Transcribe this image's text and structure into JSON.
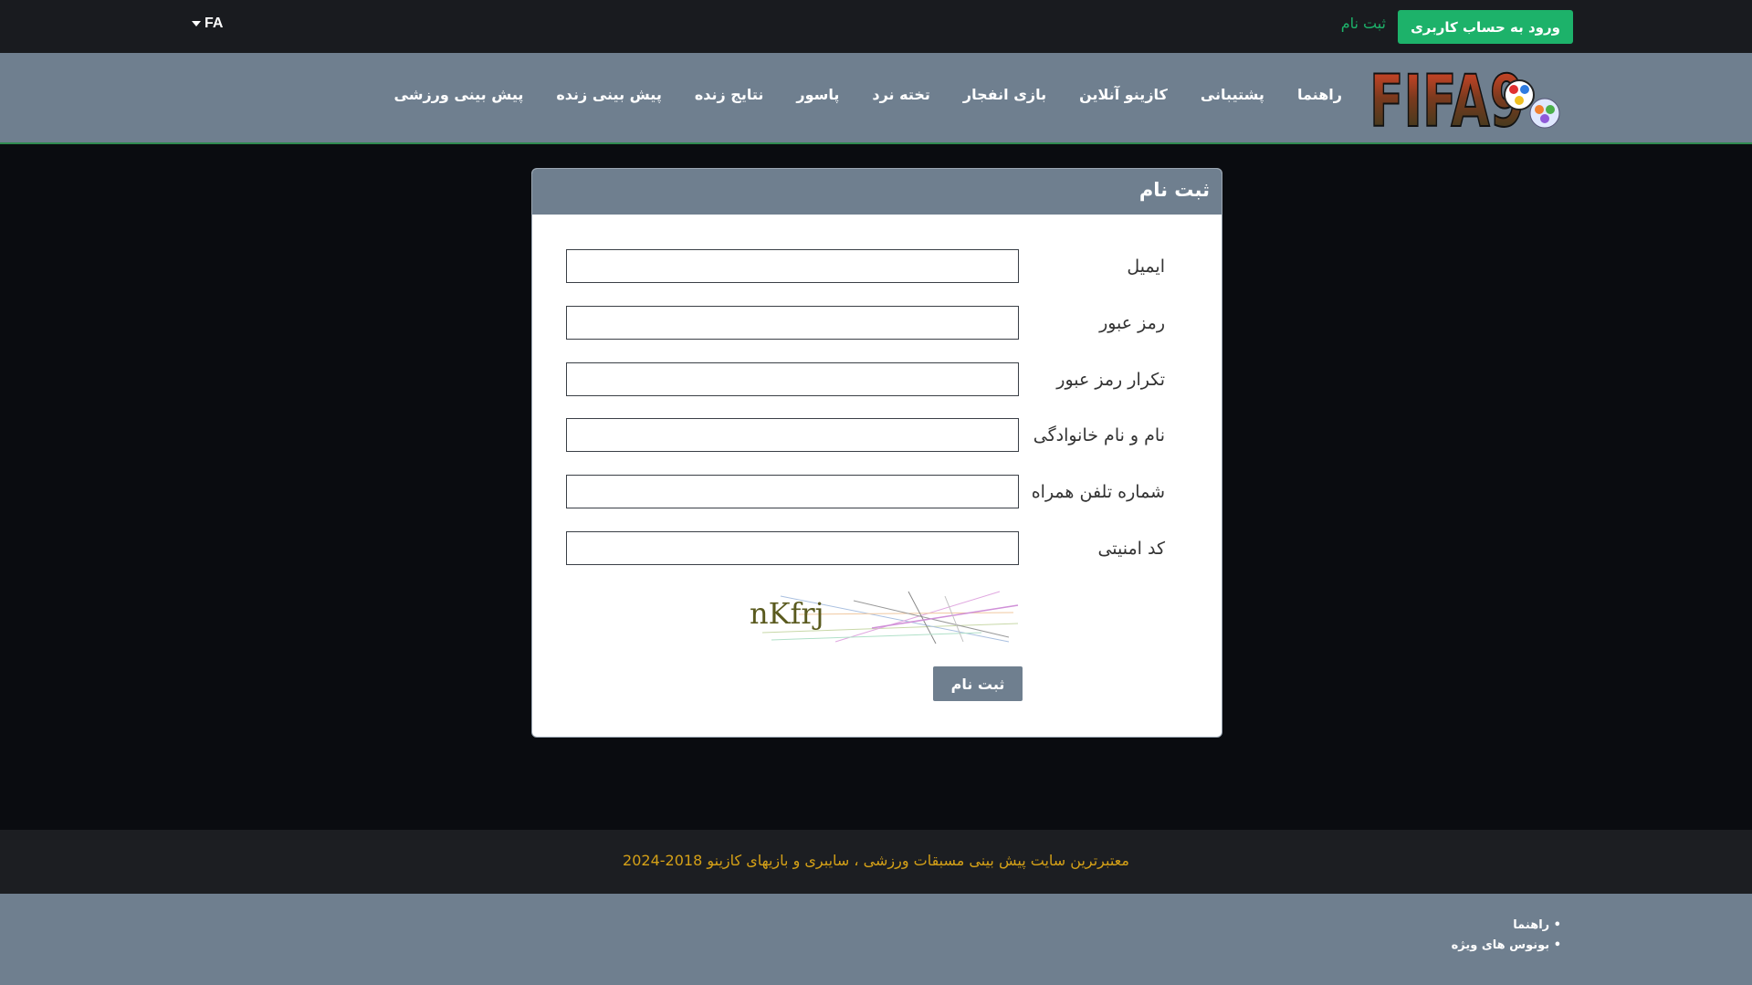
{
  "topbar": {
    "language": "FA",
    "login_button": "ورود به حساب کاربری",
    "register_link": "ثبت نام"
  },
  "logo": {
    "text": "FIFA9"
  },
  "nav": {
    "items": [
      {
        "label": "پیش بینی ورزشی"
      },
      {
        "label": "پیش بینی زنده"
      },
      {
        "label": "نتایج زنده"
      },
      {
        "label": "پاسور"
      },
      {
        "label": "تخته نرد"
      },
      {
        "label": "بازی انفجار"
      },
      {
        "label": "کازینو آنلاین"
      },
      {
        "label": "پشتیبانی"
      },
      {
        "label": "راهنما"
      }
    ]
  },
  "form": {
    "title": "ثبت نام",
    "fields": [
      {
        "label": "ایمیل",
        "value": ""
      },
      {
        "label": "رمز عبور",
        "value": ""
      },
      {
        "label": "تکرار رمز عبور",
        "value": ""
      },
      {
        "label": "نام و نام خانوادگی",
        "value": ""
      },
      {
        "label": "شماره تلفن همراه",
        "value": ""
      },
      {
        "label": "کد امنیتی",
        "value": ""
      }
    ],
    "captcha_text": "nKfrj",
    "submit_label": "ثبت نام"
  },
  "footer": {
    "copyright": "معتبرترین سایت پیش بینی مسبقات ورزشی ، سایبری و بازیهای کازینو 2018-2024",
    "links": [
      {
        "label": "• راهنما"
      },
      {
        "label": "• بونوس های ویژه"
      }
    ]
  },
  "colors": {
    "accent_green": "#1db26a",
    "nav_gray": "#6f7f8f",
    "copyright_gold": "#d4a017"
  }
}
